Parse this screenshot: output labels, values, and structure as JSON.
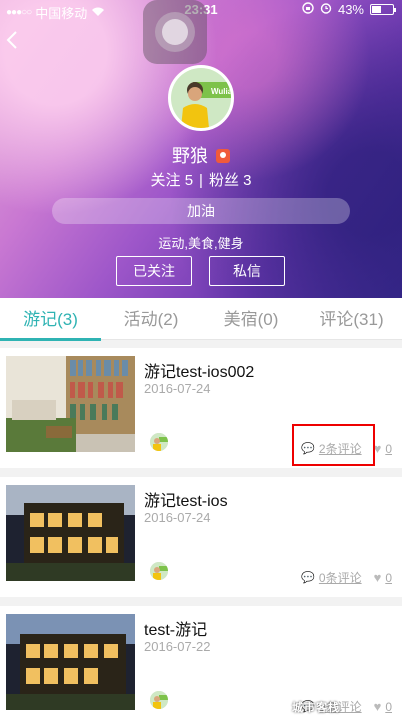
{
  "status_bar": {
    "carrier": "中国移动",
    "time": "23:31",
    "battery": "43%"
  },
  "profile": {
    "name": "野狼",
    "stats": {
      "following": "关注 5",
      "separator": "|",
      "fans": "粉丝 3"
    },
    "motto": "加油",
    "tags": "运动,美食,健身",
    "buttons": {
      "follow": "已关注",
      "message": "私信"
    },
    "avatar_text": "Wuliar"
  },
  "tabs": [
    {
      "label": "游记(3)",
      "active": true
    },
    {
      "label": "活动(2)",
      "active": false
    },
    {
      "label": "美宿(0)",
      "active": false
    },
    {
      "label": "评论(31)",
      "active": false
    }
  ],
  "posts": [
    {
      "title": "游记test-ios002",
      "date": "2016-07-24",
      "comments": "2条评论",
      "likes": "0"
    },
    {
      "title": "游记test-ios",
      "date": "2016-07-24",
      "comments": "0条评论",
      "likes": "0"
    },
    {
      "title": "test-游记",
      "date": "2016-07-22",
      "comments": "0条评论",
      "likes": "0"
    }
  ],
  "watermark": "城市客栈",
  "colors": {
    "accent": "#2fb3b3",
    "highlight": "#e00000"
  }
}
